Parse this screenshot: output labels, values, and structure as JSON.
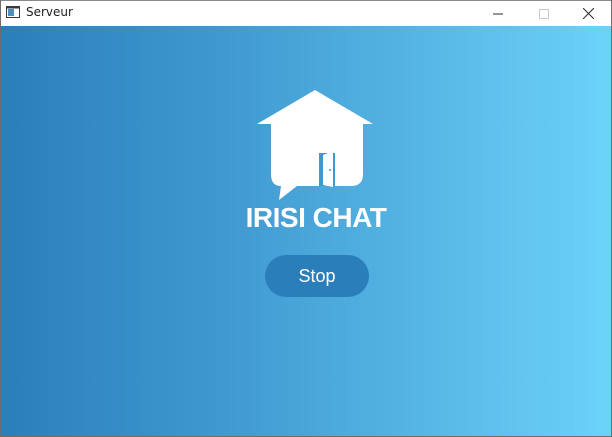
{
  "window": {
    "title": "Serveur",
    "controls": {
      "minimize": "minimize-icon",
      "maximize": "maximize-icon",
      "close": "close-icon"
    }
  },
  "main": {
    "logo_icon": "house-chat-icon",
    "brand_name": "IRISI CHAT",
    "stop_label": "Stop"
  },
  "colors": {
    "gradient_start": "#2a7fbb",
    "gradient_end": "#6cd3f9",
    "button_bg": "#2a7fbb",
    "text": "#ffffff"
  }
}
